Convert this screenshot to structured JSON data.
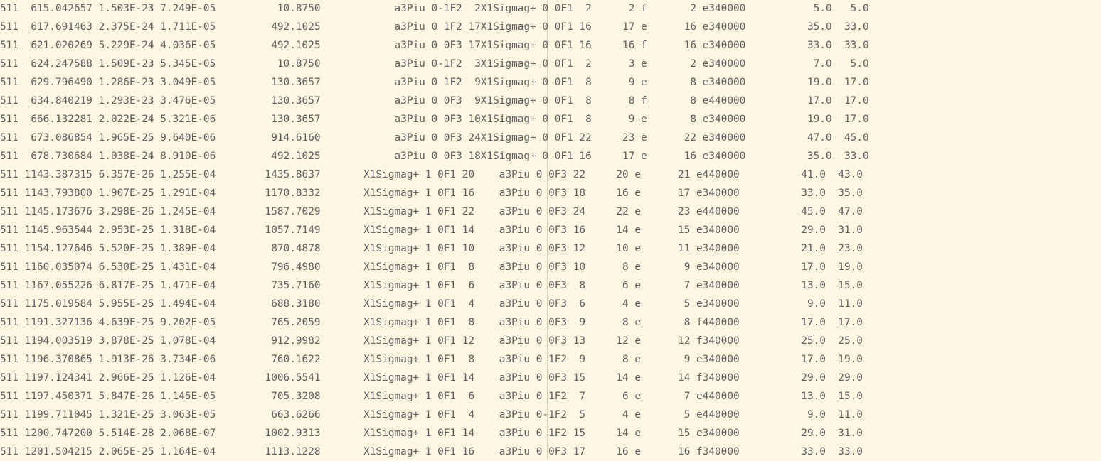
{
  "lines": [
    "511  615.042657 1.503E-23 7.249E-05          10.8750            a3Piu 0-1F2  2X1Sigmag+ 0 0F1  2      2 f       2 e340000           5.0   5.0",
    "511  617.691463 2.375E-24 1.711E-05         492.1025            a3Piu 0 1F2 17X1Sigmag+ 0 0F1 16     17 e      16 e340000          35.0  33.0",
    "511  621.020269 5.229E-24 4.036E-05         492.1025            a3Piu 0 0F3 17X1Sigmag+ 0 0F1 16     16 f      16 e340000          33.0  33.0",
    "511  624.247588 1.509E-23 5.345E-05          10.8750            a3Piu 0-1F2  3X1Sigmag+ 0 0F1  2      3 e       2 e340000           7.0   5.0",
    "511  629.796490 1.286E-23 3.049E-05         130.3657            a3Piu 0 1F2  9X1Sigmag+ 0 0F1  8      9 e       8 e340000          19.0  17.0",
    "511  634.840219 1.293E-23 3.476E-05         130.3657            a3Piu 0 0F3  9X1Sigmag+ 0 0F1  8      8 f       8 e440000          17.0  17.0",
    "511  666.132281 2.022E-24 5.321E-06         130.3657            a3Piu 0 0F3 10X1Sigmag+ 0 0F1  8      9 e       8 e340000          19.0  17.0",
    "511  673.086854 1.965E-25 9.640E-06         914.6160            a3Piu 0 0F3 24X1Sigmag+ 0 0F1 22     23 e      22 e340000          47.0  45.0",
    "511  678.730684 1.038E-24 8.910E-06         492.1025            a3Piu 0 0F3 18X1Sigmag+ 0 0F1 16     17 e      16 e340000          35.0  33.0",
    "511 1143.387315 6.357E-26 1.255E-04        1435.8637       X1Sigmag+ 1 0F1 20    a3Piu 0 0F3 22     20 e      21 e440000          41.0  43.0",
    "511 1143.793800 1.907E-25 1.291E-04        1170.8332       X1Sigmag+ 1 0F1 16    a3Piu 0 0F3 18     16 e      17 e340000          33.0  35.0",
    "511 1145.173676 3.298E-26 1.245E-04        1587.7029       X1Sigmag+ 1 0F1 22    a3Piu 0 0F3 24     22 e      23 e440000          45.0  47.0",
    "511 1145.963544 2.953E-25 1.318E-04        1057.7149       X1Sigmag+ 1 0F1 14    a3Piu 0 0F3 16     14 e      15 e340000          29.0  31.0",
    "511 1154.127646 5.520E-25 1.389E-04         870.4878       X1Sigmag+ 1 0F1 10    a3Piu 0 0F3 12     10 e      11 e340000          21.0  23.0",
    "511 1160.035074 6.530E-25 1.431E-04         796.4980       X1Sigmag+ 1 0F1  8    a3Piu 0 0F3 10      8 e       9 e340000          17.0  19.0",
    "511 1167.055226 6.817E-25 1.471E-04         735.7160       X1Sigmag+ 1 0F1  6    a3Piu 0 0F3  8      6 e       7 e340000          13.0  15.0",
    "511 1175.019584 5.955E-25 1.494E-04         688.3180       X1Sigmag+ 1 0F1  4    a3Piu 0 0F3  6      4 e       5 e340000           9.0  11.0",
    "511 1191.327136 4.639E-25 9.202E-05         765.2059       X1Sigmag+ 1 0F1  8    a3Piu 0 0F3  9      8 e       8 f440000          17.0  17.0",
    "511 1194.003519 3.878E-25 1.078E-04         912.9982       X1Sigmag+ 1 0F1 12    a3Piu 0 0F3 13     12 e      12 f340000          25.0  25.0",
    "511 1196.370865 1.913E-26 3.734E-06         760.1622       X1Sigmag+ 1 0F1  8    a3Piu 0 1F2  9      8 e       9 e340000          17.0  19.0",
    "511 1197.124341 2.966E-25 1.126E-04        1006.5541       X1Sigmag+ 1 0F1 14    a3Piu 0 0F3 15     14 e      14 f340000          29.0  29.0",
    "511 1197.450371 5.847E-26 1.145E-05         705.3208       X1Sigmag+ 1 0F1  6    a3Piu 0 1F2  7      6 e       7 e440000          13.0  15.0",
    "511 1199.711045 1.321E-25 3.063E-05         663.6266       X1Sigmag+ 1 0F1  4    a3Piu 0-1F2  5      4 e       5 e440000           9.0  11.0",
    "511 1200.747200 5.514E-28 2.068E-07        1002.9313       X1Sigmag+ 1 0F1 14    a3Piu 0 1F2 15     14 e      15 e340000          29.0  31.0",
    "511 1201.504215 2.065E-25 1.164E-04        1113.1228       X1Sigmag+ 1 0F1 16    a3Piu 0 0F3 17     16 e      16 f340000          33.0  33.0"
  ],
  "colors": {
    "background": "#fdf6e3",
    "text": "#5e5e5e",
    "guide": "#d9cfb4"
  }
}
